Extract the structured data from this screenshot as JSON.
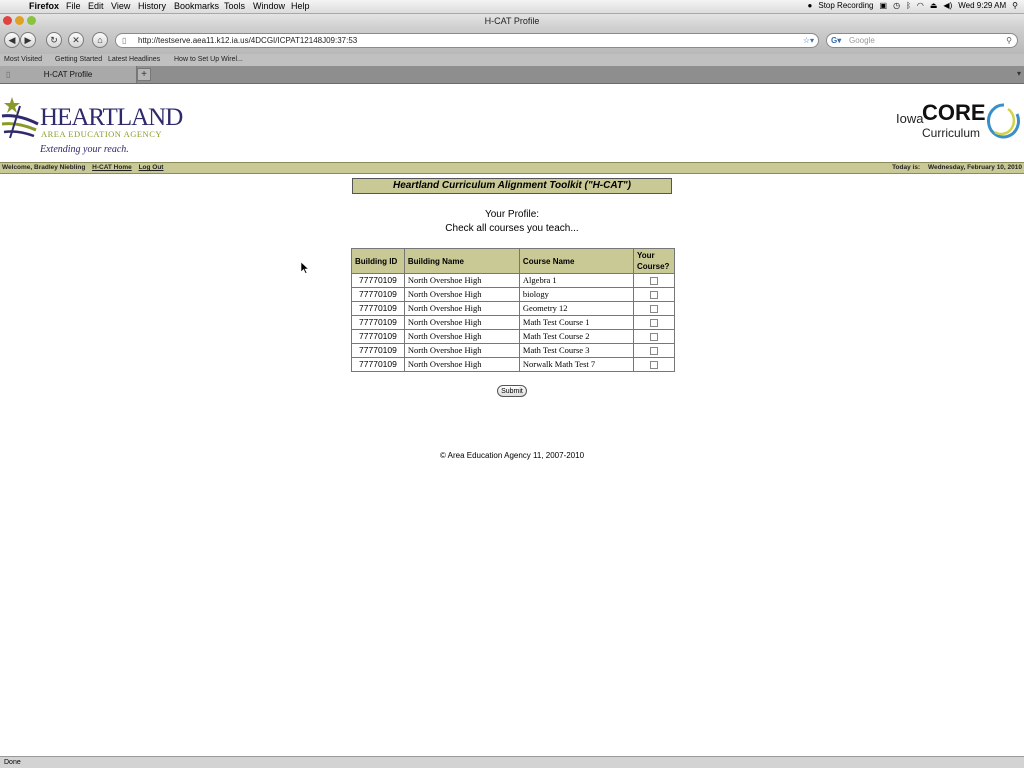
{
  "menubar": {
    "apple": "",
    "app": "Firefox",
    "items": [
      "File",
      "Edit",
      "View",
      "History",
      "Bookmarks",
      "Tools",
      "Window",
      "Help"
    ],
    "stop_recording": "Stop Recording",
    "clock": "Wed 9:29 AM"
  },
  "window": {
    "title": "H-CAT Profile"
  },
  "nav": {
    "url": "http://testserve.aea11.k12.ia.us/4DCGI/ICPAT12148J09:37:53",
    "search_placeholder": "Google"
  },
  "bookmarks": [
    "Most Visited",
    "Getting Started",
    "Latest Headlines",
    "How to Set Up Wirel..."
  ],
  "tab": {
    "label": "H-CAT Profile",
    "new_tab": "+"
  },
  "logo_left": {
    "name": "HEARTLAND",
    "sub": "AREA EDUCATION AGENCY",
    "tagline": "Extending your reach."
  },
  "logo_right": {
    "prefix": "Iowa",
    "core": "CORE",
    "curriculum": "Curriculum"
  },
  "info": {
    "welcome": "Welcome, Bradley Niebling",
    "home_link": "H-CAT Home",
    "logout_link": "Log Out",
    "today_label": "Today is:",
    "today": "Wednesday, February 10, 2010"
  },
  "toolkit_title": "Heartland Curriculum Alignment Toolkit (\"H-CAT\")",
  "profile": {
    "line1": "Your Profile:",
    "line2": "Check all courses you teach..."
  },
  "table": {
    "headers": [
      "Building ID",
      "Building Name",
      "Course Name",
      "Your Course?"
    ],
    "rows": [
      {
        "building_id": "77770109",
        "building_name": "North Overshoe High",
        "course": "Algebra 1",
        "checked": false
      },
      {
        "building_id": "77770109",
        "building_name": "North Overshoe High",
        "course": "biology",
        "checked": false
      },
      {
        "building_id": "77770109",
        "building_name": "North Overshoe High",
        "course": "Geometry 12",
        "checked": false
      },
      {
        "building_id": "77770109",
        "building_name": "North Overshoe High",
        "course": "Math Test Course 1",
        "checked": false
      },
      {
        "building_id": "77770109",
        "building_name": "North Overshoe High",
        "course": "Math Test Course 2",
        "checked": false
      },
      {
        "building_id": "77770109",
        "building_name": "North Overshoe High",
        "course": "Math Test Course 3",
        "checked": false
      },
      {
        "building_id": "77770109",
        "building_name": "North Overshoe High",
        "course": "Norwalk Math Test 7",
        "checked": false
      }
    ]
  },
  "submit_label": "Submit",
  "copyright": "© Area Education Agency 11, 2007-2010",
  "status": "Done",
  "colors": {
    "olive": "#c8c995",
    "heartland_navy": "#2e2a6b",
    "heartland_green": "#8a9a2a"
  }
}
